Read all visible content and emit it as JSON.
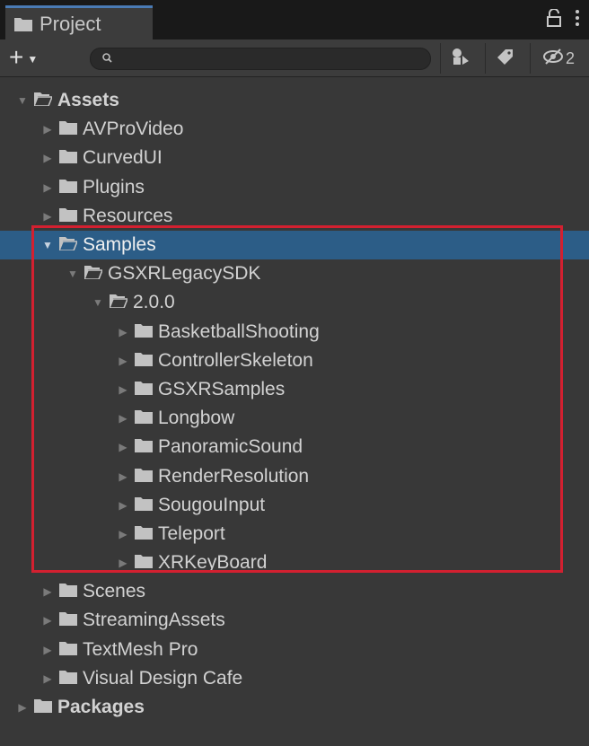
{
  "window": {
    "tab_title": "Project",
    "lock_icon": "lock-icon",
    "menu_icon": "kebab-menu-icon"
  },
  "toolbar": {
    "add_label": "+",
    "search_placeholder": "",
    "search_value": "",
    "hidden_count": "2"
  },
  "tree": [
    {
      "label": "Assets",
      "depth": 0,
      "expanded": true,
      "bold": true,
      "selected": false
    },
    {
      "label": "AVProVideo",
      "depth": 1,
      "expanded": false,
      "bold": false,
      "selected": false
    },
    {
      "label": "CurvedUI",
      "depth": 1,
      "expanded": false,
      "bold": false,
      "selected": false
    },
    {
      "label": "Plugins",
      "depth": 1,
      "expanded": false,
      "bold": false,
      "selected": false
    },
    {
      "label": "Resources",
      "depth": 1,
      "expanded": false,
      "bold": false,
      "selected": false
    },
    {
      "label": "Samples",
      "depth": 1,
      "expanded": true,
      "bold": false,
      "selected": true
    },
    {
      "label": "GSXRLegacySDK",
      "depth": 2,
      "expanded": true,
      "bold": false,
      "selected": false
    },
    {
      "label": "2.0.0",
      "depth": 3,
      "expanded": true,
      "bold": false,
      "selected": false
    },
    {
      "label": "BasketballShooting",
      "depth": 4,
      "expanded": false,
      "bold": false,
      "selected": false
    },
    {
      "label": "ControllerSkeleton",
      "depth": 4,
      "expanded": false,
      "bold": false,
      "selected": false
    },
    {
      "label": "GSXRSamples",
      "depth": 4,
      "expanded": false,
      "bold": false,
      "selected": false
    },
    {
      "label": "Longbow",
      "depth": 4,
      "expanded": false,
      "bold": false,
      "selected": false
    },
    {
      "label": "PanoramicSound",
      "depth": 4,
      "expanded": false,
      "bold": false,
      "selected": false
    },
    {
      "label": "RenderResolution",
      "depth": 4,
      "expanded": false,
      "bold": false,
      "selected": false
    },
    {
      "label": "SougouInput",
      "depth": 4,
      "expanded": false,
      "bold": false,
      "selected": false
    },
    {
      "label": "Teleport",
      "depth": 4,
      "expanded": false,
      "bold": false,
      "selected": false
    },
    {
      "label": "XRKeyBoard",
      "depth": 4,
      "expanded": false,
      "bold": false,
      "selected": false
    },
    {
      "label": "Scenes",
      "depth": 1,
      "expanded": false,
      "bold": false,
      "selected": false
    },
    {
      "label": "StreamingAssets",
      "depth": 1,
      "expanded": false,
      "bold": false,
      "selected": false
    },
    {
      "label": "TextMesh Pro",
      "depth": 1,
      "expanded": false,
      "bold": false,
      "selected": false
    },
    {
      "label": "Visual Design Cafe",
      "depth": 1,
      "expanded": false,
      "bold": false,
      "selected": false
    },
    {
      "label": "Packages",
      "depth": 0,
      "expanded": false,
      "bold": true,
      "selected": false
    }
  ],
  "colors": {
    "background": "#383838",
    "selection": "#2c5d87",
    "highlight_border": "#d32030",
    "folder": "#c2c2c2"
  }
}
